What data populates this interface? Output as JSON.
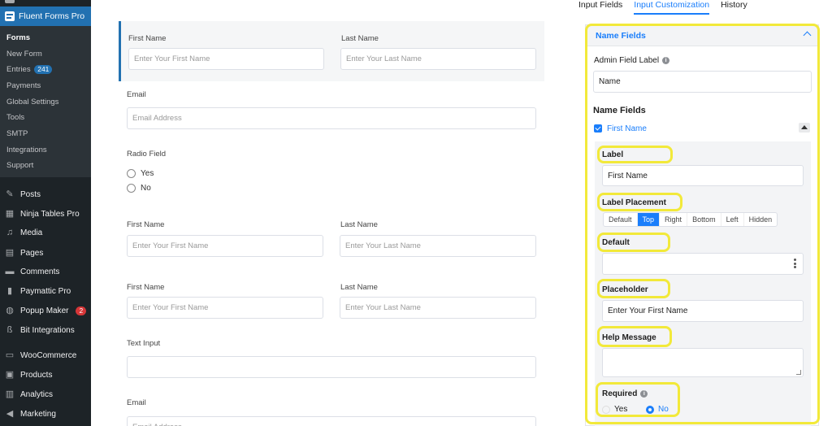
{
  "sidebar": {
    "brand": "Fluent Forms Pro",
    "submenu": {
      "forms": "Forms",
      "new_form": "New Form",
      "entries": "Entries",
      "entries_count": "241",
      "payments": "Payments",
      "global_settings": "Global Settings",
      "tools": "Tools",
      "smtp": "SMTP",
      "integrations": "Integrations",
      "support": "Support"
    },
    "menu": {
      "posts": "Posts",
      "ninja_tables": "Ninja Tables Pro",
      "media": "Media",
      "pages": "Pages",
      "comments": "Comments",
      "paymattic": "Paymattic Pro",
      "popup_maker": "Popup Maker",
      "popup_badge": "2",
      "bit_integrations": "Bit Integrations",
      "woocommerce": "WooCommerce",
      "products": "Products",
      "analytics": "Analytics",
      "marketing": "Marketing"
    }
  },
  "form": {
    "row1": {
      "first_label": "First Name",
      "first_ph": "Enter Your First Name",
      "last_label": "Last Name",
      "last_ph": "Enter Your Last Name"
    },
    "email1": {
      "label": "Email",
      "ph": "Email Address"
    },
    "radio": {
      "label": "Radio Field",
      "yes": "Yes",
      "no": "No"
    },
    "row2": {
      "first_label": "First Name",
      "first_ph": "Enter Your First Name",
      "last_label": "Last Name",
      "last_ph": "Enter Your Last Name"
    },
    "row3": {
      "first_label": "First Name",
      "first_ph": "Enter Your First Name",
      "last_label": "Last Name",
      "last_ph": "Enter Your Last Name"
    },
    "text_input": {
      "label": "Text Input"
    },
    "email2": {
      "label": "Email",
      "ph": "Email Address"
    }
  },
  "tabs": {
    "input_fields": "Input Fields",
    "input_customization": "Input Customization",
    "history": "History"
  },
  "panel": {
    "header": "Name Fields",
    "admin_label": "Admin Field Label",
    "admin_value": "Name",
    "name_fields": "Name Fields",
    "first_name": "First Name",
    "label": "Label",
    "label_value": "First Name",
    "label_placement": "Label Placement",
    "placements": [
      "Default",
      "Top",
      "Right",
      "Bottom",
      "Left",
      "Hidden"
    ],
    "default": "Default",
    "placeholder": "Placeholder",
    "placeholder_value": "Enter Your First Name",
    "help_message": "Help Message",
    "required": "Required",
    "yes": "Yes",
    "no": "No"
  },
  "colors": {
    "accent": "#1a7efb",
    "highlight": "#f2e93a",
    "sidebar": "#1d2327"
  }
}
